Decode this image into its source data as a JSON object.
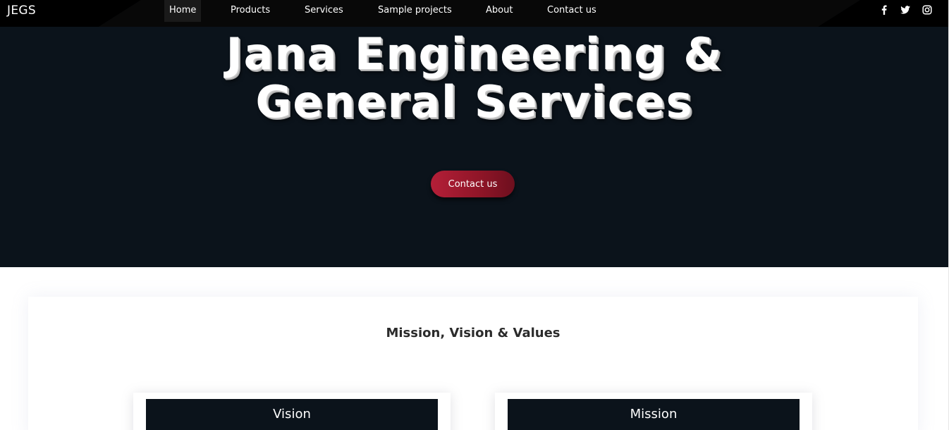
{
  "nav": {
    "brand": "JEGS",
    "links": [
      {
        "label": "Home",
        "active": true
      },
      {
        "label": "Products",
        "active": false
      },
      {
        "label": "Services",
        "active": false
      },
      {
        "label": "Sample projects",
        "active": false
      },
      {
        "label": "About",
        "active": false
      },
      {
        "label": "Contact us",
        "active": false
      }
    ],
    "social": [
      "facebook-icon",
      "twitter-icon",
      "instagram-icon"
    ]
  },
  "hero": {
    "title_line1": "Jana Engineering &",
    "title_line2": "General Services",
    "button_label": "Contact us"
  },
  "mvv": {
    "heading": "Mission, Vision & Values",
    "cards": [
      {
        "title": "Vision"
      },
      {
        "title": "Mission"
      }
    ]
  },
  "colors": {
    "dark": "#0b131b",
    "accent": "#b41f38",
    "text": "#2b2b2b"
  }
}
